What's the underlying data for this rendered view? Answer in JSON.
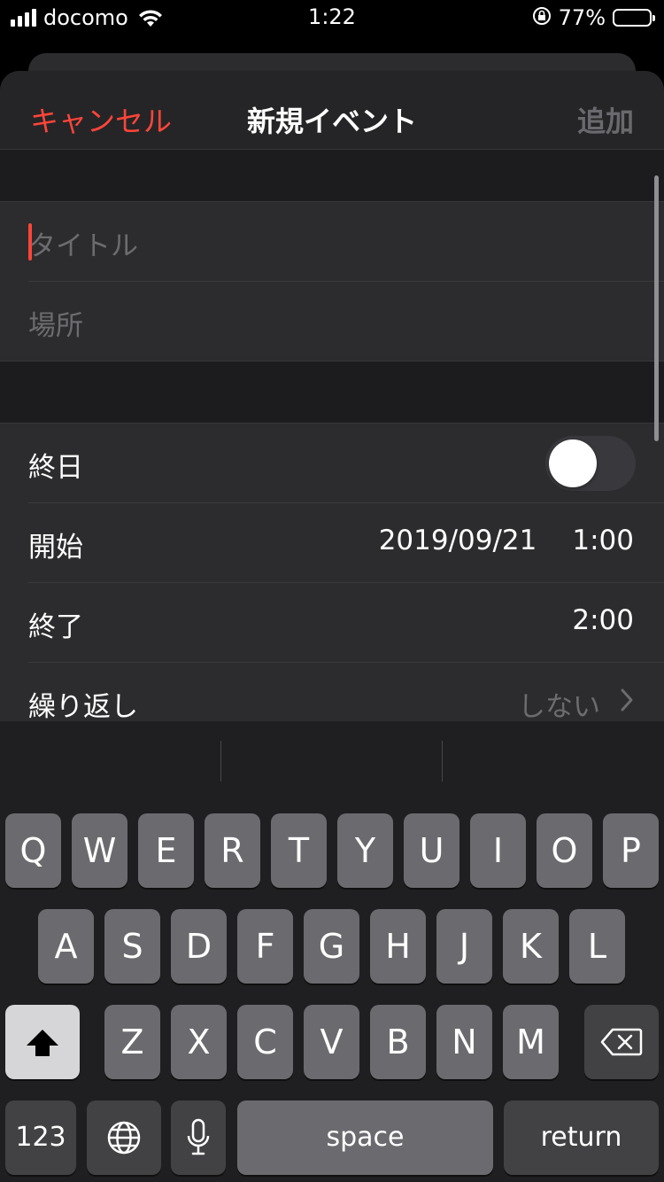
{
  "status_bar": {
    "carrier": "docomo",
    "time": "1:22",
    "battery_percent": "77%",
    "battery_level": 0.77
  },
  "nav": {
    "cancel": "キャンセル",
    "title": "新規イベント",
    "add": "追加"
  },
  "form": {
    "title_placeholder": "タイトル",
    "location_placeholder": "場所",
    "all_day_label": "終日",
    "all_day_on": false,
    "start_label": "開始",
    "start_date": "2019/09/21",
    "start_time": "1:00",
    "end_label": "終了",
    "end_time": "2:00",
    "repeat_label": "繰り返し",
    "repeat_value": "しない"
  },
  "keyboard": {
    "row1": [
      "Q",
      "W",
      "E",
      "R",
      "T",
      "Y",
      "U",
      "I",
      "O",
      "P"
    ],
    "row2": [
      "A",
      "S",
      "D",
      "F",
      "G",
      "H",
      "J",
      "K",
      "L"
    ],
    "row3": [
      "Z",
      "X",
      "C",
      "V",
      "B",
      "N",
      "M"
    ],
    "numbers_key": "123",
    "space_key": "space",
    "return_key": "return"
  }
}
